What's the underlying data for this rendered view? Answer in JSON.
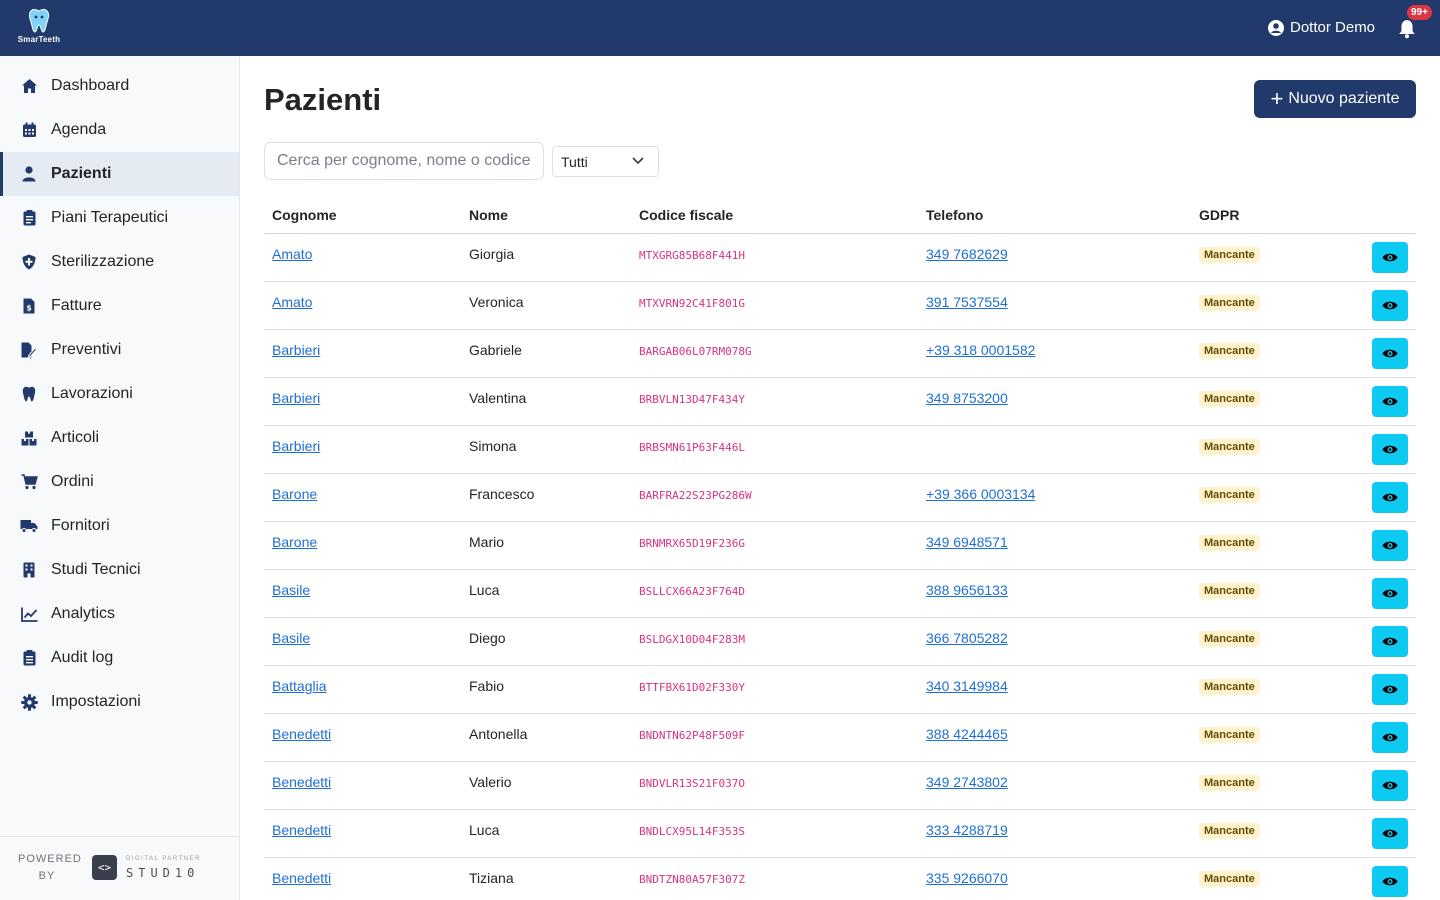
{
  "app": {
    "name": "SmarTeeth"
  },
  "header": {
    "user_name": "Dottor Demo",
    "notifications_badge": "99+"
  },
  "sidebar": {
    "items": [
      {
        "label": "Dashboard",
        "icon": "home-icon",
        "active": false
      },
      {
        "label": "Agenda",
        "icon": "calendar-icon",
        "active": false
      },
      {
        "label": "Pazienti",
        "icon": "user-icon",
        "active": true
      },
      {
        "label": "Piani Terapeutici",
        "icon": "clipboard-icon",
        "active": false
      },
      {
        "label": "Sterilizzazione",
        "icon": "shield-icon",
        "active": false
      },
      {
        "label": "Fatture",
        "icon": "invoice-icon",
        "active": false
      },
      {
        "label": "Preventivi",
        "icon": "file-edit-icon",
        "active": false
      },
      {
        "label": "Lavorazioni",
        "icon": "tooth-icon",
        "active": false
      },
      {
        "label": "Articoli",
        "icon": "boxes-icon",
        "active": false
      },
      {
        "label": "Ordini",
        "icon": "cart-icon",
        "active": false
      },
      {
        "label": "Fornitori",
        "icon": "truck-icon",
        "active": false
      },
      {
        "label": "Studi Tecnici",
        "icon": "building-icon",
        "active": false
      },
      {
        "label": "Analytics",
        "icon": "chart-line-icon",
        "active": false
      },
      {
        "label": "Audit log",
        "icon": "clipboard-list-icon",
        "active": false
      },
      {
        "label": "Impostazioni",
        "icon": "gear-icon",
        "active": false
      }
    ],
    "powered_by": "POWERED BY",
    "partner_sub": "DIGITAL PARTNER",
    "partner_name": "STUD10"
  },
  "main": {
    "title": "Pazienti",
    "new_button": "Nuovo paziente",
    "search_placeholder": "Cerca per cognome, nome o codice fiscale",
    "filter_value": "Tutti",
    "columns": [
      "Cognome",
      "Nome",
      "Codice fiscale",
      "Telefono",
      "GDPR"
    ],
    "rows": [
      {
        "cognome": "Amato",
        "nome": "Giorgia",
        "cf": "MTXGRG85B68F441H",
        "telefono": "349 7682629",
        "gdpr": "Mancante"
      },
      {
        "cognome": "Amato",
        "nome": "Veronica",
        "cf": "MTXVRN92C41F801G",
        "telefono": "391 7537554",
        "gdpr": "Mancante"
      },
      {
        "cognome": "Barbieri",
        "nome": "Gabriele",
        "cf": "BARGAB06L07RM078G",
        "telefono": "+39 318 0001582",
        "gdpr": "Mancante"
      },
      {
        "cognome": "Barbieri",
        "nome": "Valentina",
        "cf": "BRBVLN13D47F434Y",
        "telefono": "349 8753200",
        "gdpr": "Mancante"
      },
      {
        "cognome": "Barbieri",
        "nome": "Simona",
        "cf": "BRBSMN61P63F446L",
        "telefono": "",
        "gdpr": "Mancante"
      },
      {
        "cognome": "Barone",
        "nome": "Francesco",
        "cf": "BARFRA22S23PG286W",
        "telefono": "+39 366 0003134",
        "gdpr": "Mancante"
      },
      {
        "cognome": "Barone",
        "nome": "Mario",
        "cf": "BRNMRX65D19F236G",
        "telefono": "349 6948571",
        "gdpr": "Mancante"
      },
      {
        "cognome": "Basile",
        "nome": "Luca",
        "cf": "BSLLCX66A23F764D",
        "telefono": "388 9656133",
        "gdpr": "Mancante"
      },
      {
        "cognome": "Basile",
        "nome": "Diego",
        "cf": "BSLDGX10D04F283M",
        "telefono": "366 7805282",
        "gdpr": "Mancante"
      },
      {
        "cognome": "Battaglia",
        "nome": "Fabio",
        "cf": "BTTFBX61D02F330Y",
        "telefono": "340 3149984",
        "gdpr": "Mancante"
      },
      {
        "cognome": "Benedetti",
        "nome": "Antonella",
        "cf": "BNDNTN62P48F509F",
        "telefono": "388 4244465",
        "gdpr": "Mancante"
      },
      {
        "cognome": "Benedetti",
        "nome": "Valerio",
        "cf": "BNDVLR13S21F037O",
        "telefono": "349 2743802",
        "gdpr": "Mancante"
      },
      {
        "cognome": "Benedetti",
        "nome": "Luca",
        "cf": "BNDLCX95L14F353S",
        "telefono": "333 4288719",
        "gdpr": "Mancante"
      },
      {
        "cognome": "Benedetti",
        "nome": "Tiziana",
        "cf": "BNDTZN80A57F307Z",
        "telefono": "335 9266070",
        "gdpr": "Mancante"
      }
    ]
  },
  "colors": {
    "primary": "#223a6b",
    "info": "#0dcaf0",
    "link": "#1f6fd6",
    "code": "#d63384",
    "warning_bg": "#fff3cd"
  }
}
